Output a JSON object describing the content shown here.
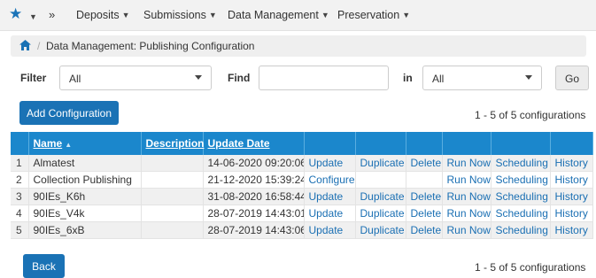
{
  "nav": {
    "star_icon": "star-icon",
    "chevron": "»",
    "items": [
      "Deposits",
      "Submissions",
      "Data Management",
      "Preservation"
    ]
  },
  "breadcrumb": {
    "home_icon": "home-icon",
    "text": "Data Management: Publishing Configuration"
  },
  "filter": {
    "filter_label": "Filter",
    "filter_value": "All",
    "find_label": "Find",
    "find_value": "",
    "in_label": "in",
    "in_value": "All",
    "go_label": "Go"
  },
  "toolbar": {
    "add_label": "Add Configuration",
    "count_text": "1 - 5 of 5 configurations"
  },
  "table": {
    "headers": {
      "name": "Name",
      "description": "Description",
      "update_date": "Update Date"
    },
    "rows": [
      {
        "num": "1",
        "name": "Almatest",
        "description": "",
        "date": "14-06-2020 09:20:06",
        "actions": [
          "Update",
          "Duplicate",
          "Delete",
          "Run Now",
          "Scheduling",
          "History"
        ]
      },
      {
        "num": "2",
        "name": "Collection Publishing",
        "description": "",
        "date": "21-12-2020 15:39:24",
        "actions": [
          "Configure",
          "",
          "",
          "Run Now",
          "Scheduling",
          "History"
        ]
      },
      {
        "num": "3",
        "name": "90IEs_K6h",
        "description": "",
        "date": "31-08-2020 16:58:44",
        "actions": [
          "Update",
          "Duplicate",
          "Delete",
          "Run Now",
          "Scheduling",
          "History"
        ]
      },
      {
        "num": "4",
        "name": "90IEs_V4k",
        "description": "",
        "date": "28-07-2019 14:43:01",
        "actions": [
          "Update",
          "Duplicate",
          "Delete",
          "Run Now",
          "Scheduling",
          "History"
        ]
      },
      {
        "num": "5",
        "name": "90IEs_6xB",
        "description": "",
        "date": "28-07-2019 14:43:06",
        "actions": [
          "Update",
          "Duplicate",
          "Delete",
          "Run Now",
          "Scheduling",
          "History"
        ]
      }
    ]
  },
  "footer": {
    "back_label": "Back",
    "count_text": "1 - 5 of 5 configurations"
  },
  "colors": {
    "accent": "#1a72b5",
    "header": "#1b87cc",
    "link": "#1a6fb3"
  }
}
